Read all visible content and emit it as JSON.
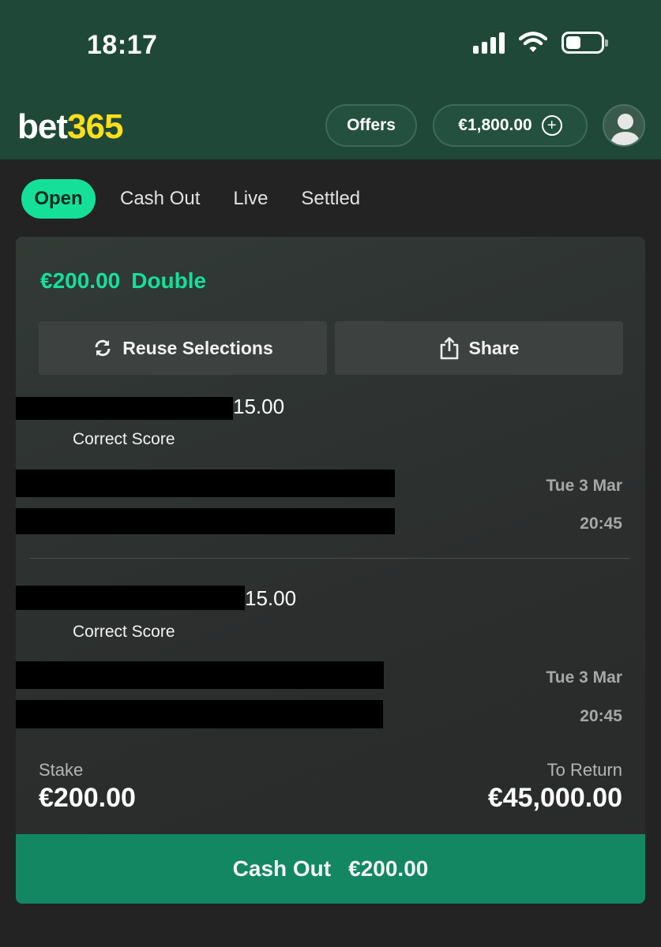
{
  "status_bar": {
    "time": "18:17",
    "icons": [
      "signal-icon",
      "wifi-icon",
      "battery-icon"
    ]
  },
  "header": {
    "logo_bet": "bet",
    "logo_num": "365",
    "offers_label": "Offers",
    "balance": "€1,800.00",
    "add_funds_glyph": "+"
  },
  "tabs": [
    {
      "label": "Open",
      "active": true
    },
    {
      "label": "Cash Out",
      "active": false
    },
    {
      "label": "Live",
      "active": false
    },
    {
      "label": "Settled",
      "active": false
    }
  ],
  "bet": {
    "stake_title": "€200.00",
    "bet_type": "Double",
    "reuse_label": "Reuse Selections",
    "share_label": "Share",
    "selections": [
      {
        "odds": "15.00",
        "market": "Correct Score",
        "date": "Tue 3 Mar",
        "time": "20:45"
      },
      {
        "odds": "15.00",
        "market": "Correct Score",
        "date": "Tue 3 Mar",
        "time": "20:45"
      }
    ],
    "stake_label": "Stake",
    "stake_value": "€200.00",
    "return_label": "To Return",
    "return_value": "€45,000.00",
    "cashout_label": "Cash Out",
    "cashout_value": "€200.00"
  },
  "colors": {
    "header_bg": "#1f4838",
    "accent_green": "#14e09a",
    "logo_yellow": "#ffdf1b",
    "cashout_bg": "#128761",
    "page_bg": "#232323"
  }
}
